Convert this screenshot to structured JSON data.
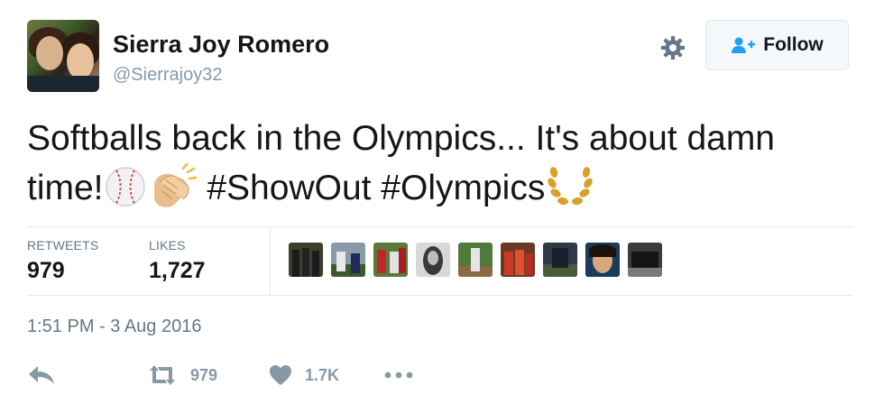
{
  "header": {
    "display_name": "Sierra Joy Romero",
    "handle": "@Sierrajoy32",
    "follow_label": "Follow"
  },
  "tweet": {
    "line1": "Softballs back in the Olympics... It's about damn",
    "line2_start": "time!",
    "hashtags": "#ShowOut #Olympics",
    "emojis": [
      "baseball-emoji",
      "clapping-hands-emoji",
      "laurel-wreath-emoji"
    ]
  },
  "stats": {
    "retweets_label": "RETWEETS",
    "retweets_value": "979",
    "likes_label": "LIKES",
    "likes_value": "1,727"
  },
  "likers": [
    "liker-avatar-1",
    "liker-avatar-2",
    "liker-avatar-3",
    "liker-avatar-4",
    "liker-avatar-5",
    "liker-avatar-6",
    "liker-avatar-7",
    "liker-avatar-8",
    "liker-avatar-9"
  ],
  "timestamp": "1:51 PM - 3 Aug 2016",
  "actions": {
    "reply_icon": "reply-icon",
    "retweet_icon": "retweet-icon",
    "retweet_count": "979",
    "like_icon": "heart-icon",
    "like_count": "1.7K",
    "more_icon": "more-icon"
  },
  "colors": {
    "text": "#14171a",
    "secondary": "#657786",
    "muted": "#8899a6",
    "divider": "#e1e8ed",
    "button_bg": "#f5f8fa"
  }
}
